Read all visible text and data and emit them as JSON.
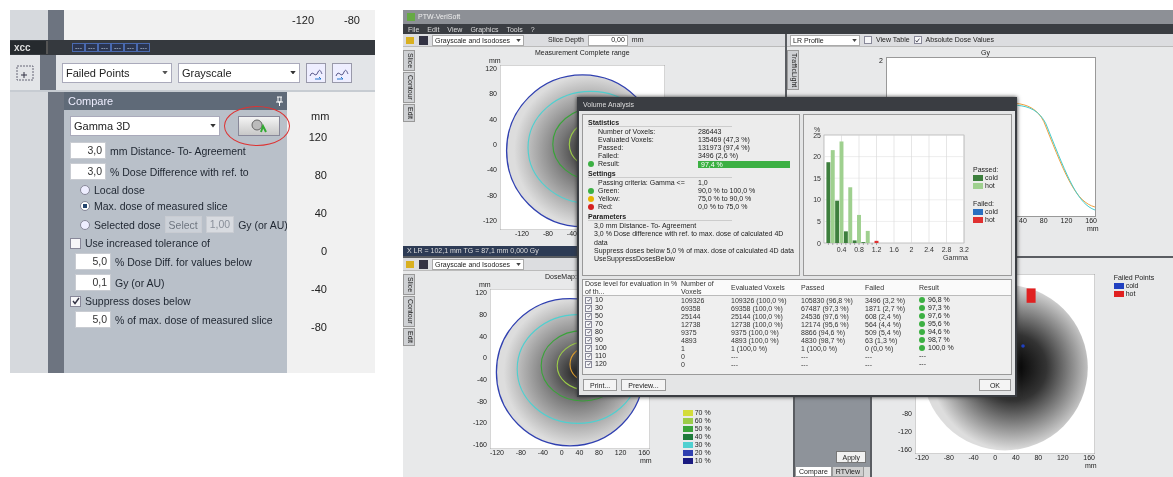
{
  "left_screenshot": {
    "top_axis_ticks": [
      "-120",
      "-80"
    ],
    "doc_tab": "xcc",
    "small_tabs": [
      "---",
      "---",
      "---",
      "---",
      "---",
      "---"
    ],
    "toolbar": {
      "display_mode": "Failed Points",
      "color_mode": "Grayscale"
    },
    "compare_panel": {
      "title": "Compare",
      "method": "Gamma 3D",
      "dta": {
        "value": "3,0",
        "label": "mm Distance- To- Agreement"
      },
      "dose_diff": {
        "value": "3,0",
        "label": "% Dose Difference with ref. to"
      },
      "reference_options": [
        {
          "label": "Local dose",
          "selected": false
        },
        {
          "label": "Max. dose of measured slice",
          "selected": true
        },
        {
          "label": "Selected dose",
          "selected": false
        }
      ],
      "select_button": {
        "label": "Select",
        "disabled": true
      },
      "selected_dose_value": "1,00",
      "selected_dose_unit": "Gy (or AU)",
      "increased_tolerance": {
        "label": "Use increased tolerance of",
        "checked": false
      },
      "tolerance_fields": [
        {
          "value": "5,0",
          "label": "% Dose Diff. for values below"
        },
        {
          "value": "0,1",
          "label": "Gy (or AU)"
        }
      ],
      "suppress": {
        "label": "Suppress doses below",
        "checked": true
      },
      "suppress_field": {
        "value": "5,0",
        "label": "% of max. dose of measured slice"
      }
    },
    "plot": {
      "unit": "mm",
      "y_ticks": [
        "120",
        "80",
        "40",
        "0",
        "-40",
        "-80"
      ]
    }
  },
  "right_screenshot": {
    "window": {
      "title": "PTW-VeriSoft"
    },
    "menu": [
      "File",
      "Edit",
      "View",
      "Graphics",
      "Tools",
      "?"
    ],
    "top_left_view": {
      "display_mode": "Grayscale and Isodoses",
      "slice_depth_label": "Slice Depth",
      "slice_depth": "0,00",
      "unit": "mm",
      "side_tabs": [
        "Slice",
        "Contour",
        "Edit"
      ],
      "title": "Measurement Complete range",
      "axis_unit": "mm",
      "y_ticks": [
        "120",
        "80",
        "40",
        "0",
        "-40",
        "-80",
        "-120"
      ],
      "x_ticks": [
        "-120",
        "-80",
        "-40"
      ],
      "status": "X  LR = 102,1 mm   TG = 87,1 mm   0,000 Gy"
    },
    "top_right_view": {
      "profile": "LR Profile",
      "view_table": {
        "label": "View Table",
        "checked": false
      },
      "absolute_dose": {
        "label": "Absolute Dose Values",
        "checked": true
      },
      "side_tab": "TrafficLight",
      "y_unit": "Gy",
      "y_ticks": [
        "2"
      ],
      "x_ticks": [
        "40",
        "80",
        "120",
        "160"
      ],
      "x_unit": "mm"
    },
    "dialog": {
      "title": "Volume Analysis",
      "statistics": {
        "heading": "Statistics",
        "rows": [
          {
            "label": "Number of Voxels:",
            "value": "286443"
          },
          {
            "label": "Evaluated Voxels:",
            "value": "135469 (47,3 %)"
          },
          {
            "label": "Passed:",
            "value": "131973 (97,4 %)"
          },
          {
            "label": "Failed:",
            "value": "3496 (2,6 %)"
          }
        ],
        "result": {
          "label": "Result:",
          "value": "97,4 %",
          "color": "#3cb043"
        }
      },
      "settings": {
        "heading": "Settings",
        "criteria_label": "Passing criteria: Gamma <=",
        "criteria_value": "1,0",
        "levels": [
          {
            "label": "Green:",
            "value": "90,0 % to 100,0 %",
            "color": "#3cb043"
          },
          {
            "label": "Yellow:",
            "value": "75,0 % to 90,0 %",
            "color": "#e8b400"
          },
          {
            "label": "Red:",
            "value": "0,0 % to 75,0 %",
            "color": "#d42020"
          }
        ]
      },
      "parameters": {
        "heading": "Parameters",
        "lines": [
          "3,0 mm Distance- To- Agreement",
          "3,0 % Dose difference with ref. to max. dose of calculated 4D data",
          "Suppress doses below 5,0 % of max. dose of calculated 4D data",
          "UseSuppressDosesBelow"
        ]
      },
      "histogram": {
        "legend_groups": [
          "Passed:",
          "Failed:"
        ],
        "chart_data": {
          "type": "bar",
          "grid": true,
          "ylabel": "%",
          "xlabel": "Gamma",
          "x": [
            0.1,
            0.2,
            0.3,
            0.4,
            0.5,
            0.6,
            0.7,
            0.8,
            0.9,
            1.0,
            1.1,
            1.2
          ],
          "xlim": [
            0,
            3.2
          ],
          "ylim": [
            0,
            25
          ],
          "xticks": [
            0.4,
            0.8,
            1.2,
            1.6,
            2,
            2.4,
            2.8,
            3.2
          ],
          "yticks": [
            0,
            5,
            10,
            15,
            20,
            25
          ],
          "series": [
            {
              "name": "cold",
              "color": "#3d7f3d",
              "values": [
                18.7,
                null,
                9.8,
                null,
                2.7,
                null,
                0.6,
                null,
                0.2,
                null,
                null,
                null
              ]
            },
            {
              "name": "hot",
              "color": "#9fd08f",
              "values": [
                null,
                21.5,
                null,
                23.5,
                null,
                12.9,
                null,
                6.5,
                null,
                2.8,
                null,
                null
              ]
            },
            {
              "name": "cold",
              "color": "#2a6fc0",
              "values": [
                null,
                null,
                null,
                null,
                null,
                null,
                null,
                null,
                null,
                null,
                null,
                null
              ]
            },
            {
              "name": "hot",
              "color": "#e03030",
              "values": [
                null,
                null,
                null,
                null,
                null,
                null,
                null,
                null,
                null,
                null,
                null,
                0.5
              ]
            }
          ]
        }
      },
      "table": {
        "columns": [
          "Dose level for evaluation in % of th...",
          "Number of Voxels",
          "Evaluated Voxels",
          "Passed",
          "Failed",
          "Result"
        ],
        "rows": [
          {
            "checked": true,
            "cells": [
              "10",
              "109326",
              "109326 (100,0 %)",
              "105830 (96,8 %)",
              "3496 (3,2 %)",
              "96,8 %"
            ],
            "color": "#3cb043"
          },
          {
            "checked": true,
            "cells": [
              "30",
              "69358",
              "69358 (100,0 %)",
              "67487 (97,3 %)",
              "1871 (2,7 %)",
              "97,3 %"
            ],
            "color": "#3cb043"
          },
          {
            "checked": true,
            "cells": [
              "50",
              "25144",
              "25144 (100,0 %)",
              "24536 (97,6 %)",
              "608 (2,4 %)",
              "97,6 %"
            ],
            "color": "#3cb043"
          },
          {
            "checked": true,
            "cells": [
              "70",
              "12738",
              "12738 (100,0 %)",
              "12174 (95,6 %)",
              "564 (4,4 %)",
              "95,6 %"
            ],
            "color": "#3cb043"
          },
          {
            "checked": true,
            "cells": [
              "80",
              "9375",
              "9375 (100,0 %)",
              "8866 (94,6 %)",
              "509 (5,4 %)",
              "94,6 %"
            ],
            "color": "#3cb043"
          },
          {
            "checked": true,
            "cells": [
              "90",
              "4893",
              "4893 (100,0 %)",
              "4830 (98,7 %)",
              "63 (1,3 %)",
              "98,7 %"
            ],
            "color": "#3cb043"
          },
          {
            "checked": true,
            "cells": [
              "100",
              "1",
              "1 (100,0 %)",
              "1 (100,0 %)",
              "0 (0,0 %)",
              "100,0 %"
            ],
            "color": "#3cb043"
          },
          {
            "checked": true,
            "cells": [
              "110",
              "0",
              "---",
              "---",
              "---",
              "---"
            ]
          },
          {
            "checked": true,
            "cells": [
              "120",
              "0",
              "---",
              "---",
              "---",
              "---"
            ]
          }
        ]
      },
      "buttons": [
        "Print...",
        "Preview..."
      ],
      "ok": "OK"
    },
    "bottom_left_view": {
      "display_mode": "Grayscale and Isodoses",
      "side_tabs": [
        "Slice",
        "Contour",
        "Edit"
      ],
      "title": "DoseMap:",
      "axis_unit": "mm",
      "y_ticks": [
        "120",
        "80",
        "40",
        "0",
        "-40",
        "-80",
        "-120",
        "-160"
      ],
      "x_ticks": [
        "-120",
        "-80",
        "-40",
        "0",
        "40",
        "80",
        "120",
        "160"
      ],
      "x_unit": "mm",
      "isodoses": [
        {
          "label": "70 %",
          "color": "#d4dc3a"
        },
        {
          "label": "60 %",
          "color": "#9ccc48"
        },
        {
          "label": "50 %",
          "color": "#3aa33a"
        },
        {
          "label": "40 %",
          "color": "#1e7a3a"
        },
        {
          "label": "30 %",
          "color": "#4fd0d0"
        },
        {
          "label": "20 %",
          "color": "#3040b0"
        },
        {
          "label": "10 %",
          "color": "#1a1a80"
        }
      ]
    },
    "bottom_middle": {
      "apply": "Apply",
      "tabs": [
        {
          "label": "Compare",
          "selected": true
        },
        {
          "label": "RTView",
          "selected": false
        }
      ]
    },
    "bottom_right_view": {
      "legend_title": "Failed Points",
      "legend": [
        {
          "label": "cold",
          "color": "#2040c0"
        },
        {
          "label": "hot",
          "color": "#e02020"
        }
      ],
      "y_ticks": [
        "-80",
        "-120",
        "-160"
      ],
      "x_ticks": [
        "-120",
        "-80",
        "-40",
        "0",
        "40",
        "80",
        "120",
        "160"
      ],
      "x_unit": "mm"
    }
  }
}
